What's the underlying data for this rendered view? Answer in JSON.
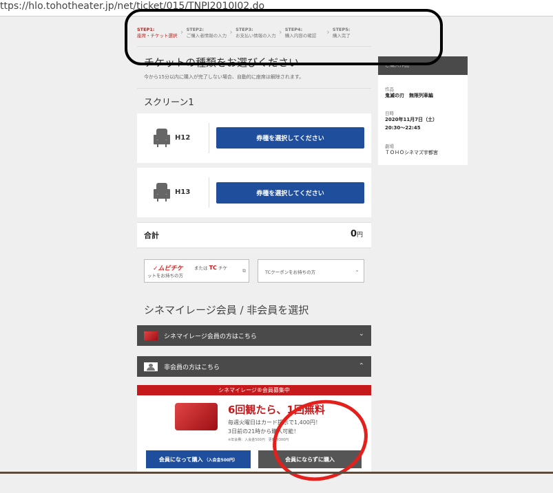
{
  "browser": {
    "url_visible": "ttps://hlo.tohotheater.jp/net/ticket/015/TNPI2010J02.do"
  },
  "steps": [
    {
      "num": "STEP1:",
      "label": "座席・チケット選択",
      "active": true
    },
    {
      "num": "STEP2:",
      "label": "ご購入者情報の入力",
      "active": false
    },
    {
      "num": "STEP3:",
      "label": "お支払い情報の入力",
      "active": false
    },
    {
      "num": "STEP4:",
      "label": "購入内容の確認",
      "active": false
    },
    {
      "num": "STEP5:",
      "label": "購入完了",
      "active": false
    }
  ],
  "ticket_section": {
    "title": "チケットの種類をお選びください",
    "notice": "今から15分以内に購入が完了しない場合、自動的に座席は解除されます。",
    "screen": "スクリーン1",
    "seats": [
      {
        "seat": "H12",
        "button": "券種を選択してください"
      },
      {
        "seat": "H13",
        "button": "券種を選択してください"
      }
    ],
    "total_label": "合計",
    "total_value": "0",
    "currency": "円"
  },
  "coupons": {
    "mubichike_logo": "ムビチケ",
    "mubichike_text_1": "または",
    "mubichike_tc": "TC",
    "mubichike_text_2": "チケ",
    "mubichike_text_3": "ットをお持ちの方",
    "tc_coupon": "TCクーポンをお持ちの方"
  },
  "membership": {
    "title": "シネマイレージ会員 / 非会員を選択",
    "member_accordion": "シネマイレージ会員の方はこちら",
    "nonmember_accordion": "非会員の方はこちら",
    "promo_bar": "シネマイレージ®会員募集中",
    "promo_headline": "6回観たら、1回無料",
    "promo_line1": "毎週火曜日はカード提示で1,400円！",
    "promo_line2": "3日前の21時から購入可能！",
    "promo_small": "※年会費：入会金500円　更新時300円",
    "btn_member": "会員になって購入",
    "btn_member_note": "（入会金500円）",
    "btn_nonmember": "会員にならずに購入"
  },
  "sidebar": {
    "header": "ご購入作品",
    "work_key": "作品",
    "work_value": "鬼滅の刃　無限列車編",
    "date_key": "日時",
    "date_line1": "2020年11月7日（土）",
    "date_line2": "20:30～22:45",
    "theater_key": "劇場",
    "theater_value": "ＴＯＨＯシネマズ宇都宮"
  },
  "colors": {
    "accent_red": "#c5191b",
    "button_blue": "#1f4e9c",
    "dark_bar": "#4a4a4a",
    "annotation_red": "#e3201b"
  }
}
